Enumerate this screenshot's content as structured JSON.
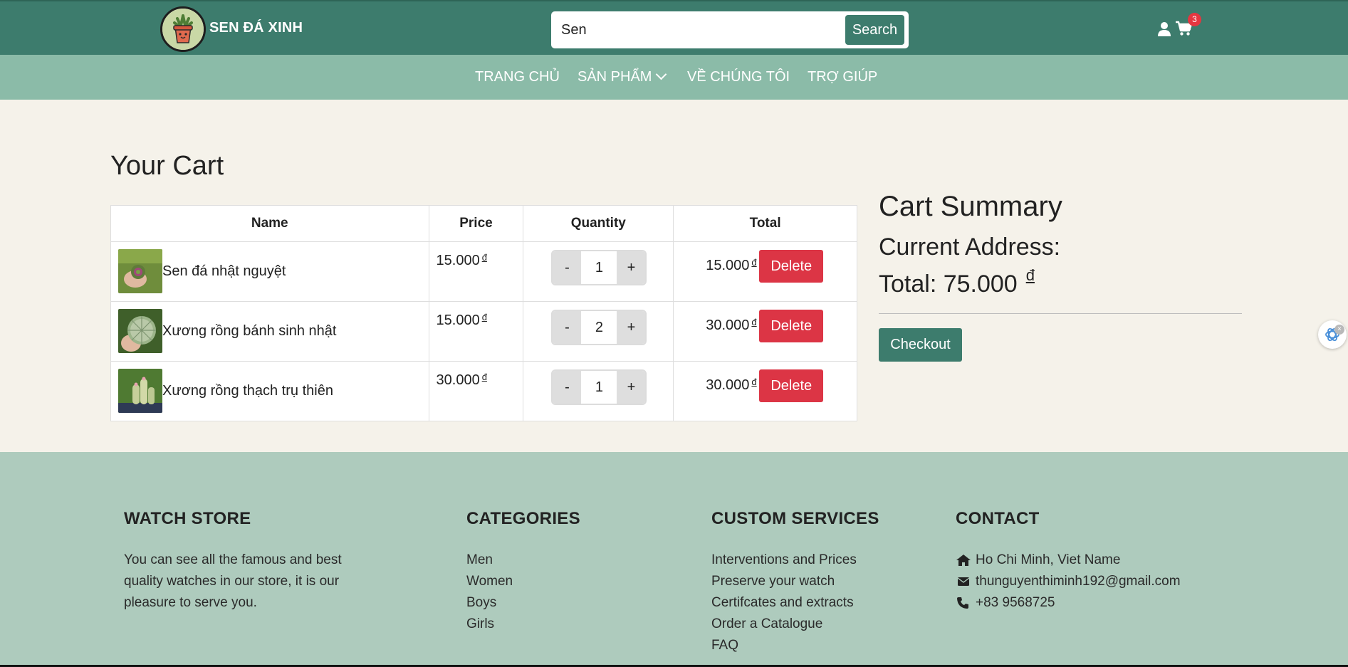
{
  "header": {
    "brand": "SEN ĐÁ XINH",
    "search": {
      "value": "Sen",
      "placeholder": "",
      "button_label": "Search"
    },
    "cart_count": "3"
  },
  "nav": {
    "items": [
      {
        "label": "TRANG CHỦ"
      },
      {
        "label": "SẢN PHẨM"
      },
      {
        "label": "VỀ CHÚNG TÔI"
      },
      {
        "label": "TRỢ GIÚP"
      }
    ]
  },
  "cart": {
    "title": "Your Cart",
    "columns": [
      "Name",
      "Price",
      "Quantity",
      "Total"
    ],
    "minus_label": "-",
    "plus_label": "+",
    "delete_label": "Delete",
    "currency": "đ",
    "rows": [
      {
        "name": "Sen đá nhật nguyệt",
        "price": "15.000",
        "quantity": "1",
        "total": "15.000"
      },
      {
        "name": "Xương rồng bánh sinh nhật",
        "price": "15.000",
        "quantity": "2",
        "total": "30.000"
      },
      {
        "name": "Xương rồng thạch trụ thiên",
        "price": "30.000",
        "quantity": "1",
        "total": "30.000"
      }
    ]
  },
  "summary": {
    "title": "Cart Summary",
    "address_label": "Current Address:",
    "total_label": "Total: 75.000",
    "currency": "đ",
    "checkout_label": "Checkout"
  },
  "footer": {
    "store": {
      "heading": "WATCH STORE",
      "text": "You can see all the famous and best quality watches in our store, it is our pleasure to serve you."
    },
    "categories": {
      "heading": "CATEGORIES",
      "items": [
        "Men",
        "Women",
        "Boys",
        "Girls"
      ]
    },
    "services": {
      "heading": "CUSTOM SERVICES",
      "items": [
        "Interventions and Prices",
        "Preserve your watch",
        "Certifcates and extracts",
        "Order a Catalogue",
        "FAQ"
      ]
    },
    "contact": {
      "heading": "CONTACT",
      "address": "Ho Chi Minh, Viet Name",
      "email": "thunguyenthiminh192@gmail.com",
      "phone": "+83 9568725"
    }
  },
  "colors": {
    "header_bg": "#3d7c6d",
    "nav_bg": "#8bbba8",
    "page_bg": "#f5f2ea",
    "footer_bg": "#aecbbd",
    "delete_red": "#dc3545",
    "badge_red": "#e53640"
  },
  "icons": [
    "succulent-logo",
    "user-icon",
    "cart-icon",
    "chevron-down-icon",
    "home-icon",
    "envelope-icon",
    "phone-icon",
    "assistant-widget-icon"
  ]
}
